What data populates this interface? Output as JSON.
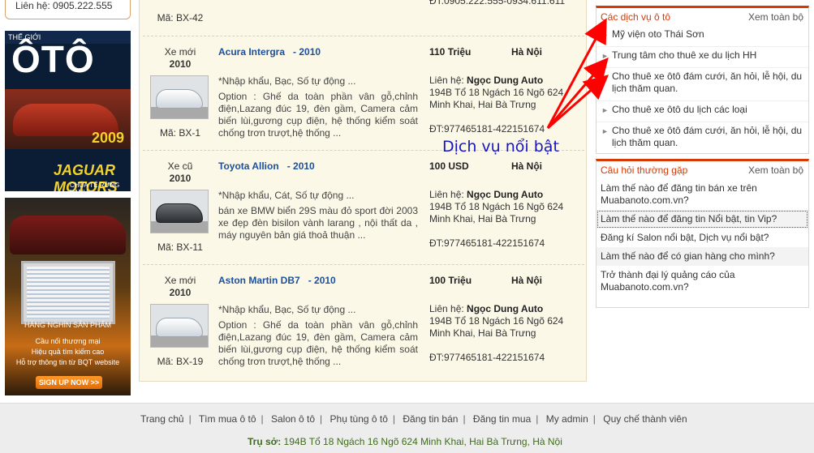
{
  "left": {
    "contact": "Liên hệ: 0905.222.555",
    "magazine": {
      "top": "THẾ GIỚI",
      "title": "ÔTÔ",
      "year": "2009",
      "brand": "JAGUAR MOTORS",
      "tagline": "CHÚA TỂ RỪNG XANH"
    },
    "banner": {
      "line1": "HÀNG NGHÌN SẢN PHẨM",
      "line2": "Cầu nối thương mại",
      "line3": "Hiệu quả tìm kiếm cao",
      "line4": "Hỗ trợ thông tin từ BQT website",
      "signup": "SIGN UP NOW >>"
    }
  },
  "top_fragment": {
    "code": "Mã: BX-42",
    "phone": "ĐT:0905.222.555-0934.611.611"
  },
  "listings": [
    {
      "condition": "Xe mới",
      "year": "2010",
      "title": "Acura Intergra",
      "title_year": "- 2010",
      "price": "110 Triệu",
      "location": "Hà Nội",
      "desc": "*Nhập khẩu, Bạc, Số tự động ...",
      "option": "Option : Ghế da toàn phần vân gỗ,chỉnh điện,Lazang đúc 19, đèn gầm, Camera cảm biến lùi,gương cụp điện, hệ thống kiểm soát chống trơn trượt,hệ thống ...",
      "contact_label": "Liên hệ:",
      "contact_name": "Ngọc Dung Auto",
      "address": "194B Tổ 18 Ngách 16 Ngõ 624 Minh Khai, Hai Bà Trưng",
      "phone": "ĐT:977465181-422151674",
      "code": "Mã: BX-1",
      "thumb": "white-car"
    },
    {
      "condition": "Xe cũ",
      "year": "2010",
      "title": "Toyota Allion",
      "title_year": "- 2010",
      "price": "100 USD",
      "location": "Hà Nội",
      "desc": "*Nhập khẩu, Cát, Số tự động ...",
      "option": "bán xe BMW biển 29S màu đỏ sport đời 2003 xe đẹp đèn bisilon vành larang , nội thất da , máy nguyên bản giá thoả thuận ...",
      "contact_label": "Liên hệ:",
      "contact_name": "Ngọc Dung Auto",
      "address": "194B Tổ 18 Ngách 16 Ngõ 624 Minh Khai, Hai Bà Trưng",
      "phone": "ĐT:977465181-422151674",
      "code": "Mã: BX-11",
      "thumb": "dark-car"
    },
    {
      "condition": "Xe mới",
      "year": "2010",
      "title": "Aston Martin DB7",
      "title_year": "- 2010",
      "price": "100 Triệu",
      "location": "Hà Nội",
      "desc": "*Nhập khẩu, Bạc, Số tự động ...",
      "option": "Option : Ghế da toàn phần vân gỗ,chỉnh điện,Lazang đúc 19, đèn gầm, Camera cảm biến lùi,gương cụp điện, hệ thống kiểm soát chống trơn trượt,hệ thống ...",
      "contact_label": "Liên hệ:",
      "contact_name": "Ngọc Dung Auto",
      "address": "194B Tổ 18 Ngách 16 Ngõ 624 Minh Khai, Hai Bà Trưng",
      "phone": "ĐT:977465181-422151674",
      "code": "Mã: BX-19",
      "thumb": "white-car"
    }
  ],
  "services": {
    "heading": "Các dịch vụ ô tô",
    "more": "Xem toàn bộ",
    "items": [
      "Mỹ viện oto Thái Sơn",
      "Trung tâm cho thuê xe du lịch HH",
      "Cho thuê xe ôtô đám cưới, ăn hỏi, lễ hội, du lịch thăm quan.",
      "Cho thuê xe ôtô du lịch các loại",
      "Cho thuê xe ôtô đám cưới, ăn hỏi, lễ hội, du lịch thăm quan."
    ]
  },
  "faq": {
    "heading": "Câu hỏi thường gặp",
    "more": "Xem toàn bộ",
    "items": [
      "Làm thế nào để đăng tin bán xe trên Muabanoto.com.vn?",
      "Làm thế nào để đăng tin Nổi bật, tin Vip?",
      "Đăng kí Salon nổi bật, Dịch vụ nổi bật?",
      "Làm thế nào để có gian hàng cho mình?",
      "Trở thành đại lý quảng cáo của Muabanoto.com.vn?"
    ]
  },
  "annotation": "Dịch vụ nổi bật",
  "footer": {
    "links": [
      "Trang chủ",
      "Tìm mua ô tô",
      "Salon ô tô",
      "Phụ tùng ô tô",
      "Đăng tin bán",
      "Đăng tin mua",
      "My admin",
      "Quy chế thành viên"
    ],
    "address_label": "Trụ sở:",
    "address": "194B Tổ 18 Ngách 16 Ngõ 624 Minh Khai, Hai Bà Trưng, Hà Nội"
  },
  "colors": {
    "link": "#1c4f9c",
    "accent": "#d43a06",
    "annotation": "#1616c7",
    "arrow": "#ff0000",
    "footer_address": "#3e6c1c"
  }
}
